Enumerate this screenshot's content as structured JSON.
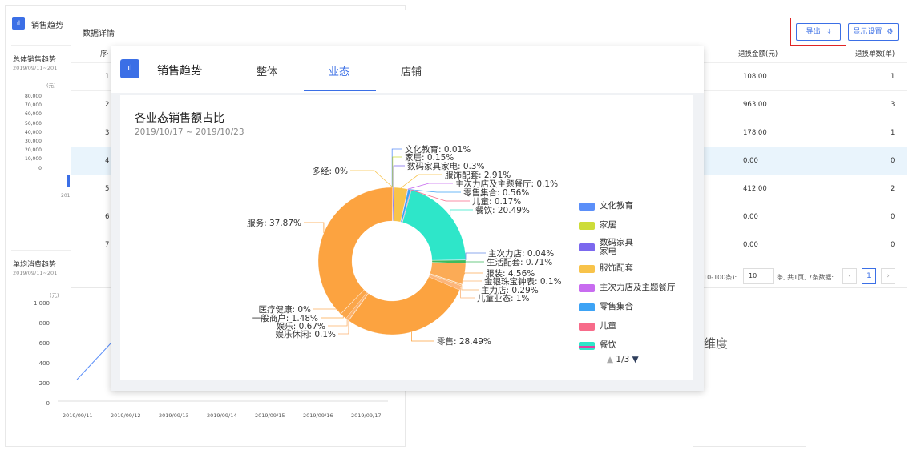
{
  "left_panel": {
    "header_title": "销售趋势",
    "total_title": "总体销售趋势",
    "total_date": "2019/09/11~201",
    "total_unit": "(元)",
    "total_yticks": [
      "80,000",
      "70,000",
      "60,000",
      "50,000",
      "40,000",
      "30,000",
      "20,000",
      "10,000",
      "0"
    ],
    "total_xstub": "201",
    "avg_title": "单均消费趋势",
    "avg_date": "2019/09/11~201",
    "avg_unit": "(元)",
    "avg_yticks": [
      "1,000",
      "800",
      "600",
      "400",
      "200",
      "0"
    ],
    "avg_xticks": [
      "2019/09/11",
      "2019/09/12",
      "2019/09/13",
      "2019/09/14",
      "2019/09/15",
      "2019/09/16",
      "2019/09/17"
    ]
  },
  "table_panel": {
    "title": "数据详情",
    "export_label": "导出",
    "display_label": "显示设置",
    "col_seq": "序号",
    "col_refund_amount": "退换金额(元)",
    "col_refund_count": "退换单数(单)",
    "rows": [
      {
        "seq": "1",
        "amount": "108.00",
        "count": "1"
      },
      {
        "seq": "2",
        "amount": "963.00",
        "count": "3"
      },
      {
        "seq": "3",
        "amount": "178.00",
        "count": "1"
      },
      {
        "seq": "4",
        "amount": "0.00",
        "count": "0"
      },
      {
        "seq": "5",
        "amount": "412.00",
        "count": "2"
      },
      {
        "seq": "6",
        "amount": "0.00",
        "count": "0"
      },
      {
        "seq": "7",
        "amount": "0.00",
        "count": "0"
      }
    ],
    "pagination": {
      "range_text": "10-100条):",
      "page_size": "10",
      "summary": "条, 共1页, 7条数据:",
      "current_page": "1"
    }
  },
  "dimension_label": "维度",
  "modal": {
    "title": "销售趋势",
    "tabs": [
      "整体",
      "业态",
      "店铺"
    ],
    "active_tab": 1
  },
  "chart_data": {
    "type": "pie",
    "variant": "donut",
    "title": "各业态销售额占比",
    "subtitle": "2019/10/17 ~ 2019/10/23",
    "slices": [
      {
        "name": "文化教育",
        "value": 0.01,
        "label": "文化教育: 0.01%",
        "color": "#5b8ff9"
      },
      {
        "name": "家居",
        "value": 0.15,
        "label": "家居: 0.15%",
        "color": "#cddc39"
      },
      {
        "name": "数码家具家电",
        "value": 0.3,
        "label": "数码家具家电: 0.3%",
        "color": "#7b68ee"
      },
      {
        "name": "服饰配套",
        "value": 2.91,
        "label": "服饰配套: 2.91%",
        "color": "#f8c34a"
      },
      {
        "name": "主次力店及主题餐厅",
        "value": 0.1,
        "label": "主次力店及主题餐厅: 0.1%",
        "color": "#c86cf0"
      },
      {
        "name": "零售集合",
        "value": 0.56,
        "label": "零售集合: 0.56%",
        "color": "#3da3f5"
      },
      {
        "name": "儿童",
        "value": 0.17,
        "label": "儿童: 0.17%",
        "color": "#f76b8a"
      },
      {
        "name": "餐饮",
        "value": 20.49,
        "label": "餐饮: 20.49%",
        "color": "#2ee6c9"
      },
      {
        "name": "主次力店",
        "value": 0.04,
        "label": "主次力店: 0.04%",
        "color": "#6a8de8"
      },
      {
        "name": "生活配套",
        "value": 0.71,
        "label": "生活配套: 0.71%",
        "color": "#3dbb5e"
      },
      {
        "name": "服装",
        "value": 4.56,
        "label": "服装: 4.56%",
        "color": "#fbab56"
      },
      {
        "name": "金银珠宝钟表",
        "value": 0.1,
        "label": "金银珠宝钟表: 0.1%",
        "color": "#fbb874"
      },
      {
        "name": "主力店",
        "value": 0.29,
        "label": "主力店: 0.29%",
        "color": "#f9b36a"
      },
      {
        "name": "儿童业态",
        "value": 1,
        "label": "儿童业态: 1%",
        "color": "#fcb57a"
      },
      {
        "name": "零售",
        "value": 28.49,
        "label": "零售: 28.49%",
        "color": "#fca340"
      },
      {
        "name": "娱乐休闲",
        "value": 0.1,
        "label": "娱乐休闲: 0.1%",
        "color": "#fbb474"
      },
      {
        "name": "娱乐",
        "value": 0.67,
        "label": "娱乐: 0.67%",
        "color": "#fcb16a"
      },
      {
        "name": "一般商户",
        "value": 1.48,
        "label": "一般商户: 1.48%",
        "color": "#fba64a"
      },
      {
        "name": "医疗健康",
        "value": 0,
        "label": "医疗健康: 0%",
        "color": "#fcb060"
      },
      {
        "name": "服务",
        "value": 37.87,
        "label": "服务: 37.87%",
        "color": "#fca340"
      },
      {
        "name": "多经",
        "value": 0,
        "label": "多经: 0%",
        "color": "#f8c34a"
      }
    ],
    "legend": [
      {
        "name": "文化教育",
        "color": "#5b8ff9"
      },
      {
        "name": "家居",
        "color": "#cddc39"
      },
      {
        "name": "数码家具\n家电",
        "color": "#7b68ee"
      },
      {
        "name": "服饰配套",
        "color": "#f8c34a"
      },
      {
        "name": "主次力店及主题餐厅",
        "color": "#c86cf0"
      },
      {
        "name": "零售集合",
        "color": "#3da3f5"
      },
      {
        "name": "儿童",
        "color": "#f76b8a"
      },
      {
        "name": "餐饮",
        "color": "#2ee6c9"
      }
    ],
    "legend_page": "1/3",
    "legend_placement": "right"
  }
}
